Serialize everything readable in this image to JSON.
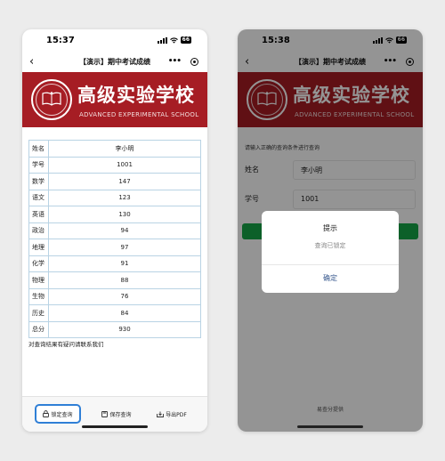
{
  "phone1": {
    "status": {
      "time": "15:37",
      "battery": "66"
    },
    "nav": {
      "back": "‹",
      "title": "【演示】期中考试成绩",
      "more": "•••"
    },
    "school": {
      "name_cn": "高级实验学校",
      "name_en": "ADVANCED EXPERIMENTAL SCHOOL"
    },
    "rows": [
      {
        "k": "姓名",
        "v": "李小明"
      },
      {
        "k": "学号",
        "v": "1001"
      },
      {
        "k": "数学",
        "v": "147"
      },
      {
        "k": "语文",
        "v": "123"
      },
      {
        "k": "英语",
        "v": "130"
      },
      {
        "k": "政治",
        "v": "94"
      },
      {
        "k": "地理",
        "v": "97"
      },
      {
        "k": "化学",
        "v": "91"
      },
      {
        "k": "物理",
        "v": "88"
      },
      {
        "k": "生物",
        "v": "76"
      },
      {
        "k": "历史",
        "v": "84"
      },
      {
        "k": "总分",
        "v": "930"
      }
    ],
    "contact_note": "对查询结果有疑问请联系我们",
    "toolbar": {
      "lock_label": "锁定查询",
      "save_label": "保存查询",
      "pdf_label": "导出PDF"
    }
  },
  "phone2": {
    "status": {
      "time": "15:38",
      "battery": "66"
    },
    "nav": {
      "back": "‹",
      "title": "【演示】期中考试成绩",
      "more": "•••"
    },
    "school": {
      "name_cn": "高级实验学校",
      "name_en": "ADVANCED EXPERIMENTAL SCHOOL"
    },
    "hint": "请输入正确的查询条件进行查询",
    "fields": [
      {
        "label": "姓名",
        "value": "李小明"
      },
      {
        "label": "学号",
        "value": "1001"
      }
    ],
    "footer": "易查分提供",
    "dialog": {
      "title": "提示",
      "message": "查询已锁定",
      "ok": "确定"
    }
  },
  "colors": {
    "banner": "#a61d24",
    "highlight": "#2f7fd6",
    "query_button": "#15a547",
    "table_border": "#b9d3e4"
  },
  "icons": [
    "back-chevron-icon",
    "more-dots-icon",
    "mini-program-target-icon",
    "signal-icon",
    "wifi-icon",
    "lock-icon",
    "save-icon",
    "pdf-icon",
    "school-emblem-icon"
  ]
}
